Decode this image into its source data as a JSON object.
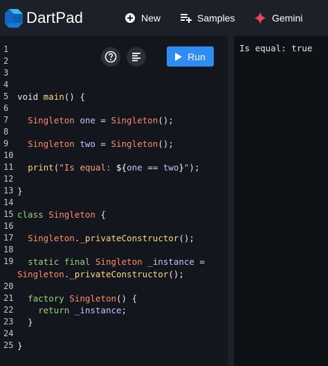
{
  "app": {
    "title": "DartPad"
  },
  "nav": {
    "new_label": "New",
    "samples_label": "Samples",
    "gemini_label": "Gemini"
  },
  "editor": {
    "run_label": "Run",
    "line_numbers": [
      "1",
      "2",
      "3",
      "4",
      "5",
      "6",
      "7",
      "8",
      "9",
      "10",
      "11",
      "12",
      "13",
      "14",
      "15",
      "16",
      "17",
      "18",
      "19",
      "20",
      "21",
      "22",
      "23",
      "24",
      "25"
    ]
  },
  "code": {
    "l5_kw": "void",
    "l5_fn": "main",
    "l5_rest": "() {",
    "l7_type": "Singleton",
    "l7_var": "one",
    "l7_eq": " = ",
    "l7_ctor": "Singleton",
    "l7_end": "();",
    "l9_type": "Singleton",
    "l9_var": "two",
    "l9_eq": " = ",
    "l9_ctor": "Singleton",
    "l9_end": "();",
    "l11_fn": "print",
    "l11_open": "(",
    "l11_str": "\"Is equal: ",
    "l11_interp_open": "${",
    "l11_a": "one",
    "l11_op": " == ",
    "l11_b": "two",
    "l11_interp_close": "}",
    "l11_str_end": "\"",
    "l11_end": ");",
    "l13": "}",
    "l15_kw": "class",
    "l15_cls": "Singleton",
    "l15_rest": " {",
    "l17_cls": "Singleton",
    "l17_dot": ".",
    "l17_fn": "_privateConstructor",
    "l17_end": "();",
    "l19_kw": "static final",
    "l19_cls": "Singleton",
    "l19_var": "_instance",
    "l19_eq": " =",
    "l19b_cls": "Singleton",
    "l19b_dot": ".",
    "l19b_fn": "_privateConstructor",
    "l19b_end": "();",
    "l21_kw": "factory",
    "l21_cls": "Singleton",
    "l21_end": "() {",
    "l22_kw": "return",
    "l22_var": "_instance",
    "l22_end": ";",
    "l23": "}",
    "l25": "}"
  },
  "output": {
    "text": "Is equal: true"
  },
  "colors": {
    "run_button": "#2f8cf2",
    "gemini_accent": "#e8475a"
  }
}
